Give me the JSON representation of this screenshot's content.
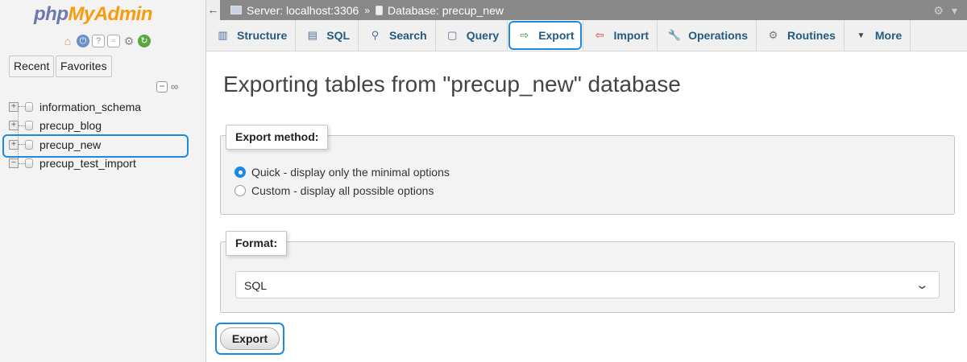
{
  "sidebar": {
    "logo_part1": "php",
    "logo_part2": "MyAdmin",
    "quick_icons": [
      "home-icon",
      "logout-icon",
      "docs-icon",
      "copy-icon",
      "settings-icon",
      "reload-icon"
    ],
    "recent_label": "Recent",
    "favorites_label": "Favorites",
    "databases": [
      {
        "name": "information_schema",
        "expander": "+"
      },
      {
        "name": "precup_blog",
        "expander": "+"
      },
      {
        "name": "precup_new",
        "expander": "+",
        "highlighted": true
      },
      {
        "name": "precup_test_import",
        "expander": "−"
      }
    ]
  },
  "topbar": {
    "back_glyph": "←",
    "server": "Server: localhost:3306",
    "separator": "»",
    "database": "Database: precup_new"
  },
  "tabs": [
    {
      "label": "Structure",
      "icon": "structure-icon",
      "glyph": "▥"
    },
    {
      "label": "SQL",
      "icon": "sql-icon",
      "glyph": "▤"
    },
    {
      "label": "Search",
      "icon": "search-icon",
      "glyph": "⚲"
    },
    {
      "label": "Query",
      "icon": "query-icon",
      "glyph": "▢"
    },
    {
      "label": "Export",
      "icon": "export-icon",
      "glyph": "⇨",
      "active": true
    },
    {
      "label": "Import",
      "icon": "import-icon",
      "glyph": "⇦"
    },
    {
      "label": "Operations",
      "icon": "wrench-icon",
      "glyph": "🔧"
    },
    {
      "label": "Routines",
      "icon": "routines-icon",
      "glyph": "⚙"
    },
    {
      "label": "More",
      "icon": "chevron-down-icon",
      "glyph": "▼"
    }
  ],
  "main": {
    "title": "Exporting tables from \"precup_new\" database",
    "export_method_legend": "Export method:",
    "quick_option": "Quick - display only the minimal options",
    "custom_option": "Custom - display all possible options",
    "selected_method": "quick",
    "format_legend": "Format:",
    "format_value": "SQL",
    "export_button": "Export"
  },
  "colors": {
    "accent": "#1e88e5",
    "tab_text": "#235a81",
    "topbar": "#888888"
  }
}
